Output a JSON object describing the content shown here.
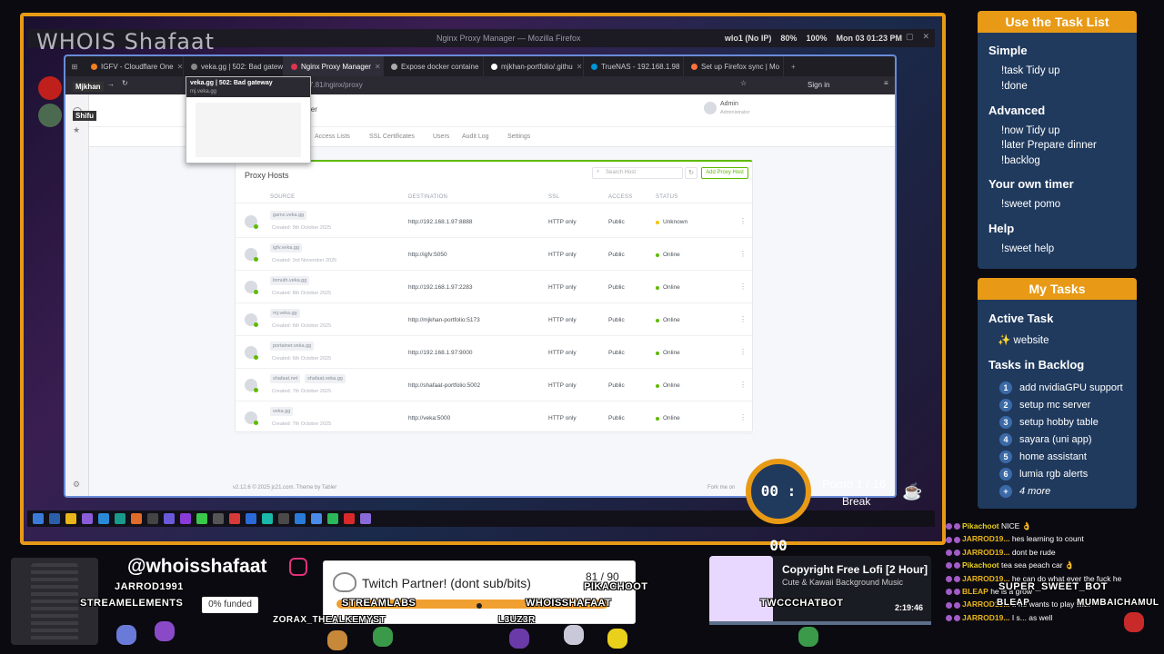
{
  "stream": {
    "overlay_title": "WHOIS Shafaat",
    "handle": "@whoisshafaat",
    "funded": "0% funded",
    "viewer_names": [
      "JARROD1991",
      "STREAMELEMENTS",
      "ZORAX_THEALKEMYST",
      "STREAMLABS",
      "WHOISSHAFAAT",
      "L3UZ3R",
      "PIKACHOOT",
      "TWCCCHATBOT",
      "SUPER_SWEET_BOT",
      "MUMBAICHAMUL",
      "BLEAP"
    ]
  },
  "desktop": {
    "window_title": "Nginx Proxy Manager — Mozilla Firefox",
    "status": {
      "network": "wlo1 (No IP)",
      "volume": "80%",
      "battery": "100%",
      "datetime": "Mon 03 01:23 PM"
    }
  },
  "profile": {
    "name1": "Mjkhan",
    "name2": "Shifu"
  },
  "browser": {
    "tabs": [
      {
        "label": "IGFV - Cloudflare One",
        "color": "#f38020"
      },
      {
        "label": "veka.gg | 502: Bad gatew",
        "color": "#888888"
      },
      {
        "label": "Nginx Proxy Manager",
        "color": "#e0344c",
        "active": true
      },
      {
        "label": "Expose docker containe",
        "color": "#aaaaaa"
      },
      {
        "label": "mjkhan-portfolio/.githu",
        "color": "#ffffff"
      },
      {
        "label": "TrueNAS - 192.168.1.98",
        "color": "#0095d5"
      },
      {
        "label": "Set up Firefox sync | Mo",
        "color": "#ff7139"
      }
    ],
    "url": "7.81/nginx/proxy",
    "signin": "Sign in",
    "preview": {
      "title": "veka.gg | 502: Bad gateway",
      "url": "mj.veka.gg"
    }
  },
  "npm": {
    "title_partial": "anager",
    "user": {
      "name": "Admin",
      "role": "Administrator"
    },
    "nav": [
      "Access Lists",
      "SSL Certificates",
      "Users",
      "Audit Log",
      "Settings"
    ],
    "card_title": "Proxy Hosts",
    "search_placeholder": "Search Host",
    "add_label": "Add Proxy Host",
    "columns": [
      "SOURCE",
      "DESTINATION",
      "SSL",
      "ACCESS",
      "STATUS"
    ],
    "rows": [
      {
        "domain": "gamz.veka.gg",
        "created": "Created: 9th October 2025",
        "dest": "http://192.168.1.97:8888",
        "ssl": "HTTP only",
        "access": "Public",
        "status": "Unknown",
        "status_color": "#f1c40f"
      },
      {
        "domain": "igfv.veka.gg",
        "created": "Created: 3rd November 2025",
        "dest": "http://igfv:5050",
        "ssl": "HTTP only",
        "access": "Public",
        "status": "Online",
        "status_color": "#5eba00"
      },
      {
        "domain": "lnmuth.veka.gg",
        "created": "Created: 8th October 2025",
        "dest": "http://192.168.1.97:2283",
        "ssl": "HTTP only",
        "access": "Public",
        "status": "Online",
        "status_color": "#5eba00"
      },
      {
        "domain": "mj.veka.gg",
        "created": "Created: 6th October 2025",
        "dest": "http://mjkhan-portfolio:5173",
        "ssl": "HTTP only",
        "access": "Public",
        "status": "Online",
        "status_color": "#5eba00"
      },
      {
        "domain": "portainer.veka.gg",
        "created": "Created: 6th October 2025",
        "dest": "http://192.168.1.97:9000",
        "ssl": "HTTP only",
        "access": "Public",
        "status": "Online",
        "status_color": "#5eba00"
      },
      {
        "domain": "shafaat.net",
        "domain2": "shafaat.veka.gg",
        "created": "Created: 7th October 2025",
        "dest": "http://shafaat-portfolio:5002",
        "ssl": "HTTP only",
        "access": "Public",
        "status": "Online",
        "status_color": "#5eba00"
      },
      {
        "domain": "veka.gg",
        "created": "Created: 7th October 2025",
        "dest": "http://veka:5000",
        "ssl": "HTTP only",
        "access": "Public",
        "status": "Online",
        "status_color": "#5eba00"
      }
    ],
    "footer": "v2.12.6 © 2025 jc21.com. Theme by Tabler",
    "footer_right": "Fork me on"
  },
  "task_list": {
    "title": "Use the Task List",
    "sections": [
      {
        "heading": "Simple",
        "cmds": [
          "!task Tidy up",
          "!done"
        ]
      },
      {
        "heading": "Advanced",
        "cmds": [
          "!now Tidy up",
          "!later Prepare dinner",
          "!backlog"
        ]
      },
      {
        "heading": "Your own timer",
        "cmds": [
          "!sweet pomo"
        ]
      },
      {
        "heading": "Help",
        "cmds": [
          "!sweet help"
        ]
      }
    ]
  },
  "my_tasks": {
    "title": "My Tasks",
    "active_heading": "Active Task",
    "active": "✨ website",
    "backlog_heading": "Tasks in Backlog",
    "backlog": [
      "add nvidiaGPU support",
      "setup mc server",
      "setup hobby table",
      "sayara (uni app)",
      "home assistant",
      "lumia rgb alerts"
    ],
    "more": "4 more"
  },
  "pomo": {
    "time": "00 : 00",
    "label": "Pomo  1  /  16",
    "state": "Break"
  },
  "partner": {
    "title": "Twitch Partner! (dont sub/bits)",
    "count": "81 / 90",
    "progress": 0.9
  },
  "music": {
    "title": "Copyright Free Lofi [2 Hour]",
    "subtitle": "Cute & Kawaii Background Music",
    "time": "2:19:46"
  },
  "chat": [
    {
      "user": "Pikachoot",
      "msg": "NICE 👌"
    },
    {
      "user": "JARROD19...",
      "msg": "hes learning to count"
    },
    {
      "user": "JARROD19...",
      "msg": "dont be rude"
    },
    {
      "user": "Pikachoot",
      "msg": "tea sea peach car 👌"
    },
    {
      "user": "JARROD19...",
      "msg": "he can do what ever the fuck he"
    },
    {
      "user": "BLEAP",
      "msg": "he is a grow"
    },
    {
      "user": "JARROD19...",
      "msg": "If he wants to play with"
    },
    {
      "user": "JARROD19...",
      "msg": "I s... as well"
    }
  ],
  "colors": {
    "accent": "#e89a16",
    "panel": "#203a5e",
    "npm_green": "#5eba00"
  }
}
